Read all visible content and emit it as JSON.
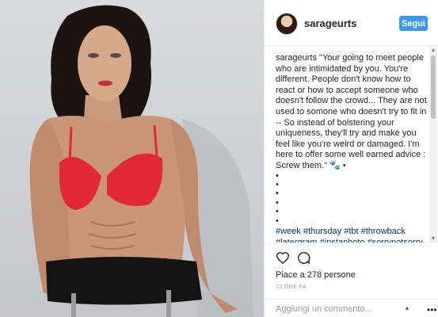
{
  "header": {
    "username": "sarageurts",
    "follow_label": "Segui"
  },
  "caption": {
    "author": "sarageurts",
    "text": " \"Your going to meet people who are intimidated by you. You're different. People don't know how to react or how to accept someone who doesn't follow the crowd... They are not used to somone who doesn't try to fit in -- So instead of bolstering your uniqueness, they'll try and make you feel like you're weird or damaged. I'm here to offer some well earned advice : Screw them.\" 🐾 •",
    "dots": [
      "•",
      "•",
      "•",
      "•",
      "•",
      "•"
    ],
    "hashtags": "#week #thursday #tbt #throwback #latergram #instaphoto #sorrynotsorry #victoriassecret #qotd #ehlersdanlosawareness"
  },
  "actions": {
    "like_icon": "heart-icon",
    "comment_icon": "comment-icon",
    "likes_text": "Piace a 278 persone",
    "timestamp": "12 ORE FA"
  },
  "comment_box": {
    "placeholder": "Aggiungi un commento...",
    "more_icon": "more-icon"
  },
  "colors": {
    "follow_button": "#3897f0",
    "hashtag": "#003569",
    "bikini": "#e0283a",
    "chair": "#141414"
  }
}
